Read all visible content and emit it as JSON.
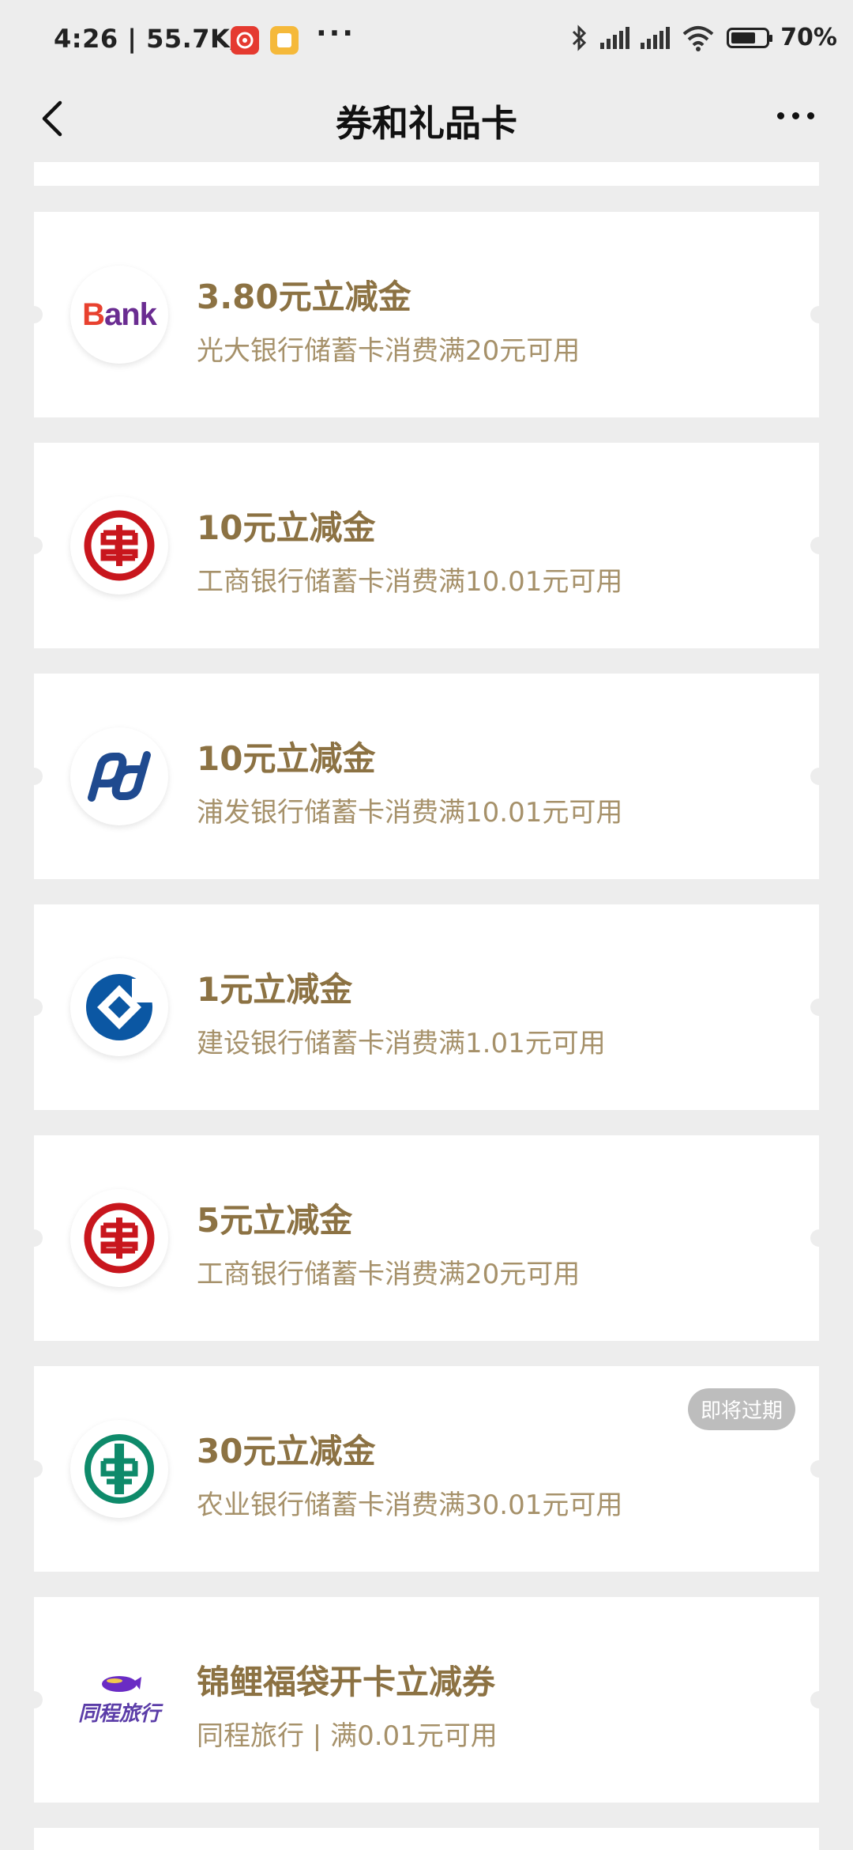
{
  "status_bar": {
    "time": "4:26 | 55.7K/s",
    "dots": "···",
    "battery_level": 0.7,
    "battery_text": "70%"
  },
  "header": {
    "title": "券和礼品卡"
  },
  "colors": {
    "title_gold": "#8c7243",
    "desc_gold": "#a6916a",
    "background": "#ededed",
    "badge_bg": "#bdbdbd"
  },
  "coupons": [
    {
      "title": "3.80元立减金",
      "desc": "光大银行储蓄卡消费满20元可用",
      "logo": "everbright-bank-icon"
    },
    {
      "title": "10元立减金",
      "desc": "工商银行储蓄卡消费满10.01元可用",
      "logo": "icbc-icon"
    },
    {
      "title": "10元立减金",
      "desc": "浦发银行储蓄卡消费满10.01元可用",
      "logo": "spdb-icon"
    },
    {
      "title": "1元立减金",
      "desc": "建设银行储蓄卡消费满1.01元可用",
      "logo": "ccb-icon"
    },
    {
      "title": "5元立减金",
      "desc": "工商银行储蓄卡消费满20元可用",
      "logo": "icbc-icon"
    },
    {
      "title": "30元立减金",
      "desc": "农业银行储蓄卡消费满30.01元可用",
      "logo": "abc-icon",
      "badge": "即将过期"
    },
    {
      "title": "锦鲤福袋开卡立减券",
      "desc": "同程旅行 | 满0.01元可用",
      "logo": "tongcheng-icon"
    }
  ],
  "logo_text": {
    "bank_b": "B",
    "bank_rest": "ank",
    "tongcheng": "同程旅行"
  }
}
